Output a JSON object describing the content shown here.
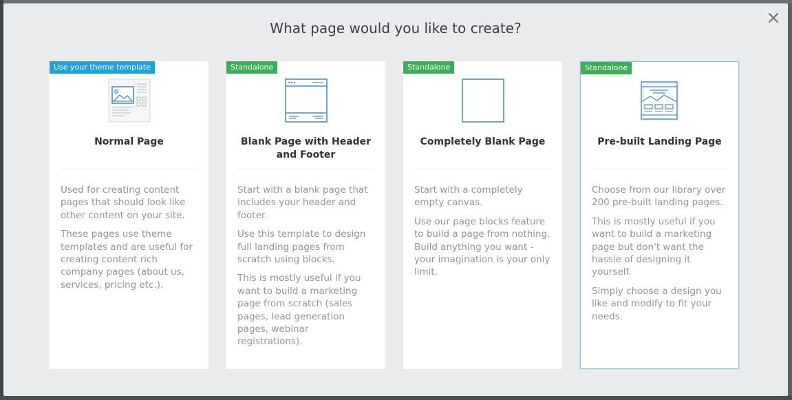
{
  "modal": {
    "title": "What page would you like to create?",
    "close_label": "×"
  },
  "cards": [
    {
      "badge": "Use your theme template",
      "badge_color": "#1fa1d9",
      "icon": "normal-page-icon",
      "title": "Normal Page",
      "paragraphs": [
        "Used for creating content pages that should look like other content on your site.",
        "These pages use theme templates and are useful for creating content rich company pages (about us, services, pricing etc.)."
      ]
    },
    {
      "badge": "Standalone",
      "badge_color": "#3eae56",
      "icon": "header-footer-page-icon",
      "title": "Blank Page with Header and Footer",
      "paragraphs": [
        "Start with a blank page that includes your header and footer.",
        "Use this template to design full landing pages from scratch using blocks.",
        "This is mostly useful if you want to build a marketing page from scratch (sales pages, lead generation pages, webinar registrations)."
      ]
    },
    {
      "badge": "Standalone",
      "badge_color": "#3eae56",
      "icon": "blank-page-icon",
      "title": "Completely Blank Page",
      "paragraphs": [
        "Start with a completely empty canvas.",
        "Use our page blocks feature to build a page from nothing. Build anything you want - your imagination is your only limit."
      ]
    },
    {
      "badge": "Standalone",
      "badge_color": "#3eae56",
      "icon": "landing-page-icon",
      "title": "Pre-built Landing Page",
      "selected": true,
      "paragraphs": [
        "Choose from our library over 200 pre-built landing pages.",
        "This is mostly useful if you want to build a marketing page but don't want the hassle of designing it yourself.",
        "Simply choose a design you like and modify to fit your needs."
      ]
    }
  ]
}
